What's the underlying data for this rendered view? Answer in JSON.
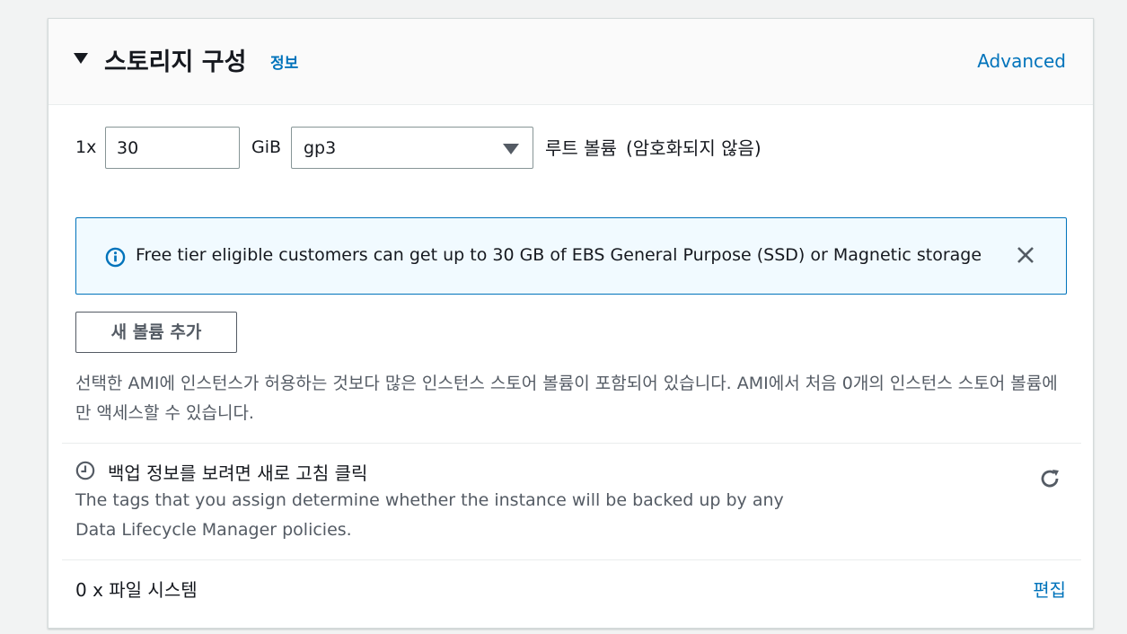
{
  "section": {
    "title": "스토리지 구성",
    "info_label": "정보",
    "advanced_label": "Advanced"
  },
  "root_volume": {
    "count_label": "1x",
    "size_value": "30",
    "unit_label": "GiB",
    "volume_type": "gp3",
    "label": "루트 볼륨",
    "encryption_label": "(암호화되지 않음)"
  },
  "alert": {
    "message": "Free tier eligible customers can get up to 30 GB of EBS General Purpose (SSD) or Magnetic storage",
    "icon": "info-icon",
    "close_icon": "close-icon"
  },
  "add_volume_label": "새 볼륨 추가",
  "instance_store_note": "선택한 AMI에 인스턴스가 허용하는 것보다 많은 인스턴스 스토어 볼륨이 포함되어 있습니다. AMI에서 처음 0개의 인스턴스 스토어 볼륨에만 액세스할 수 있습니다.",
  "backup": {
    "title": "백업 정보를 보려면 새로 고침 클릭",
    "description": "The tags that you assign determine whether the instance will be backed up by any Data Lifecycle Manager policies.",
    "icon": "clock-icon",
    "refresh_icon": "refresh-icon"
  },
  "file_systems": {
    "label": "0 x 파일 시스템",
    "edit_label": "편집"
  },
  "colors": {
    "link": "#0073bb",
    "alert_border": "#0073bb",
    "alert_bg": "#f1faff",
    "text": "#16191f",
    "secondary_text": "#545b64"
  }
}
